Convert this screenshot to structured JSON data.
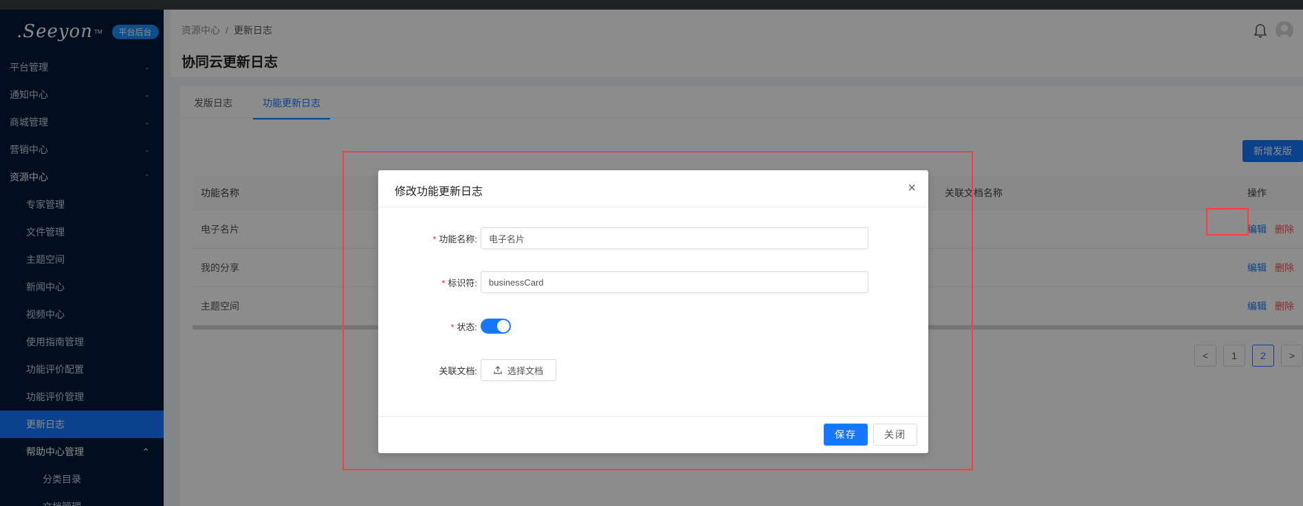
{
  "sidebar": {
    "logo": "Seeyon",
    "logo_tm": "TM",
    "badge": "平台后台",
    "menu": [
      {
        "label": "平台管理"
      },
      {
        "label": "通知中心"
      },
      {
        "label": "商城管理"
      },
      {
        "label": "营销中心"
      },
      {
        "label": "资源中心"
      }
    ],
    "resource_items": [
      {
        "label": "专家管理"
      },
      {
        "label": "文件管理"
      },
      {
        "label": "主题空间"
      },
      {
        "label": "新闻中心"
      },
      {
        "label": "视频中心"
      },
      {
        "label": "使用指南管理"
      },
      {
        "label": "功能评价配置"
      },
      {
        "label": "功能评价管理"
      },
      {
        "label": "更新日志"
      }
    ],
    "help_group": "帮助中心管理",
    "help_items": [
      {
        "label": "分类目录"
      },
      {
        "label": "文档管理"
      }
    ]
  },
  "header": {
    "breadcrumb": [
      "资源中心",
      "更新日志"
    ],
    "breadcrumb_sep": "/",
    "title": "协同云更新日志"
  },
  "tabs": [
    {
      "label": "发版日志"
    },
    {
      "label": "功能更新日志"
    }
  ],
  "add_button": "新增发版",
  "table": {
    "columns": [
      "功能名称",
      "关联文档名称",
      "操作"
    ],
    "rows": [
      {
        "name": "电子名片",
        "edit": "编辑",
        "delete": "删除"
      },
      {
        "name": "我的分享",
        "edit": "编辑",
        "delete": "删除"
      },
      {
        "name": "主题空间",
        "edit": "编辑",
        "delete": "删除"
      }
    ]
  },
  "pagination": {
    "prev": "<",
    "pages": [
      "1",
      "2"
    ],
    "current": "2",
    "next": ">"
  },
  "modal": {
    "title": "修改功能更新日志",
    "close_icon": "×",
    "fields": {
      "name_label": "功能名称:",
      "name_value": "电子名片",
      "id_label": "标识符:",
      "id_value": "businessCard",
      "status_label": "状态:",
      "status_on": true,
      "doc_label": "关联文档:",
      "doc_button": "选择文档"
    },
    "required_mark": "*",
    "save": "保存",
    "close": "关闭"
  },
  "colors": {
    "primary": "#1677ff",
    "danger": "#ff4d4f",
    "sidebar_bg": "#011a3a",
    "highlight": "#ff3b3b"
  }
}
